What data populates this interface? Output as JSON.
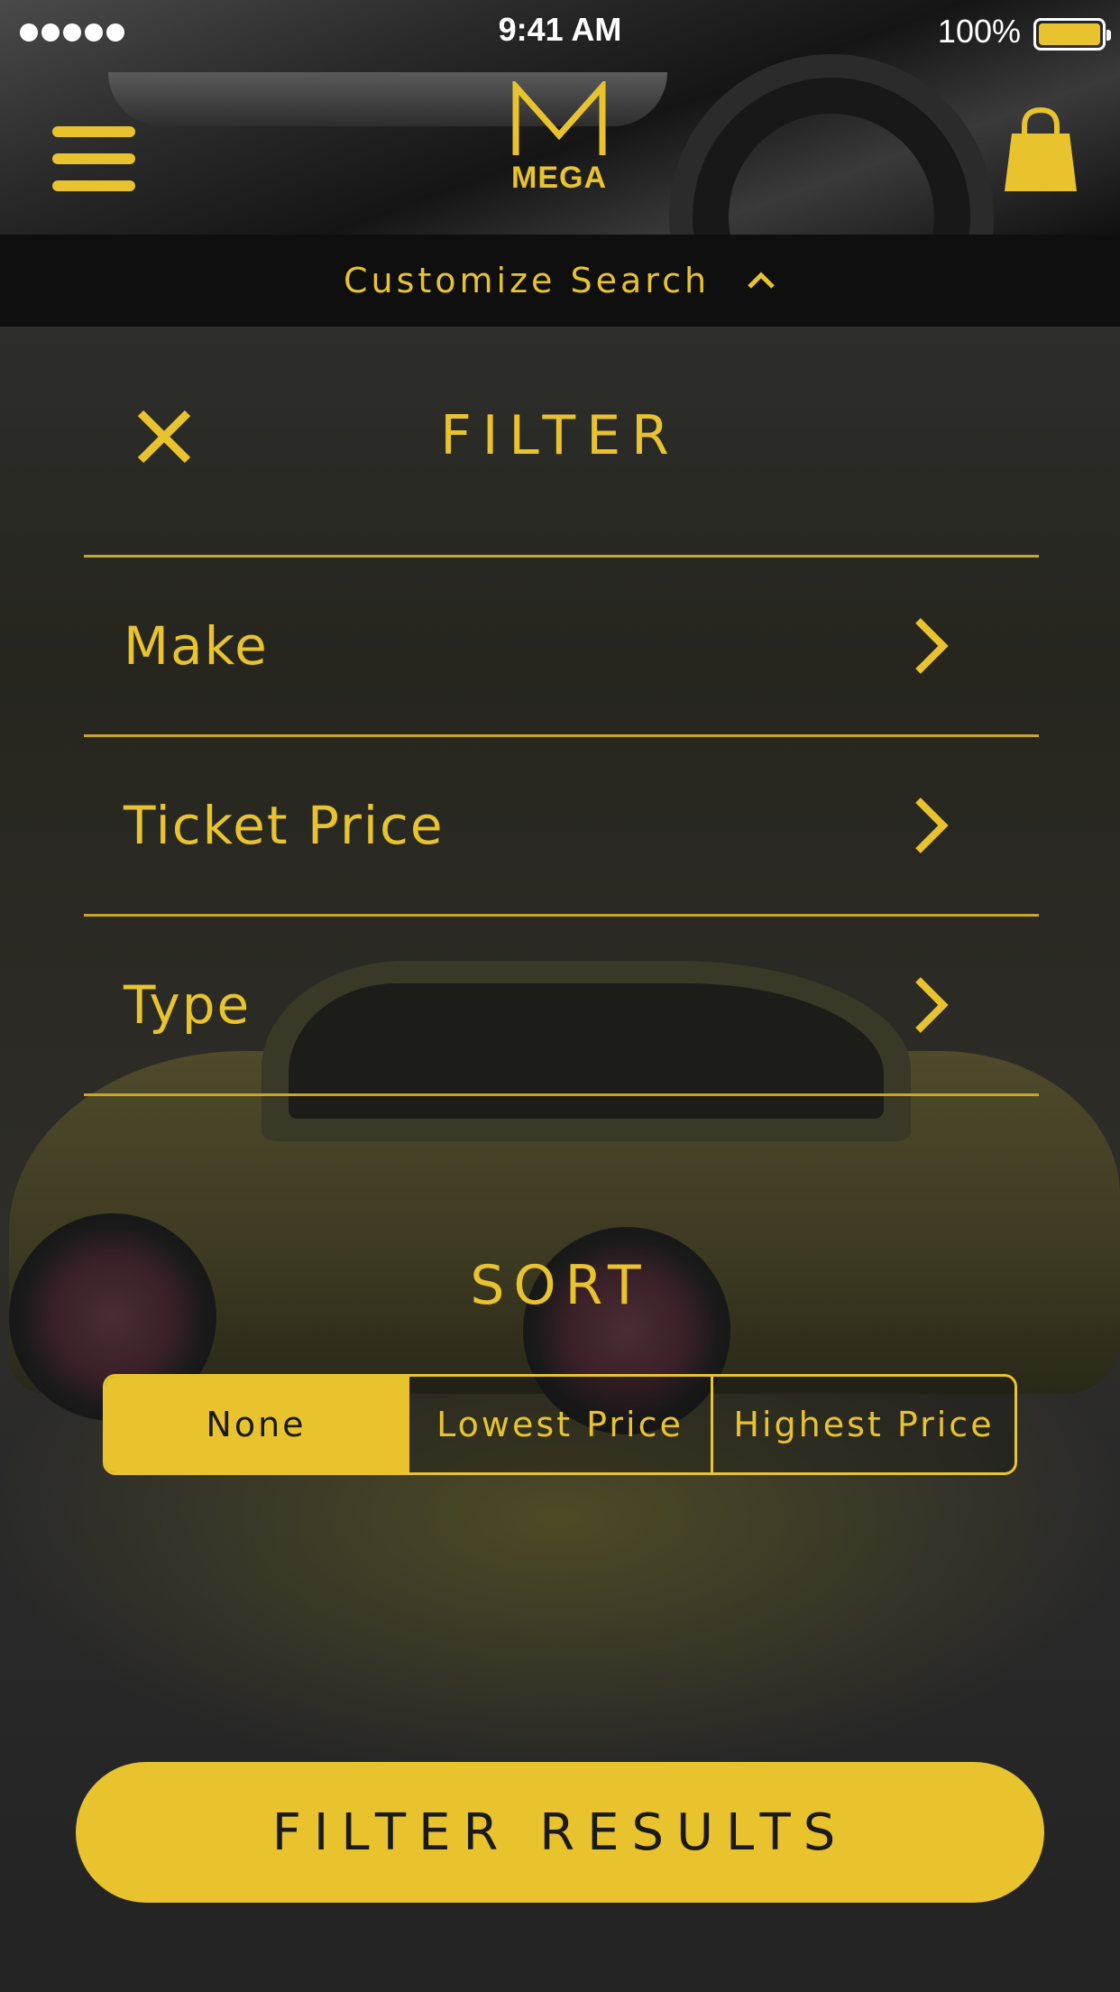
{
  "status_bar": {
    "time": "9:41 AM",
    "battery_percent": "100%",
    "battery_level": 1.0,
    "signal_bars": 5
  },
  "header": {
    "logo_text": "MEGA",
    "menu_icon": "hamburger-menu-icon",
    "bag_icon": "shopping-bag-icon"
  },
  "customize_search": {
    "label": "Customize Search",
    "icon": "chevron-up-icon"
  },
  "filter": {
    "title": "FILTER",
    "close_icon": "close-icon",
    "items": [
      {
        "label": "Make"
      },
      {
        "label": "Ticket Price"
      },
      {
        "label": "Type"
      }
    ]
  },
  "sort": {
    "title": "SORT",
    "options": [
      {
        "label": "None",
        "selected": true
      },
      {
        "label": "Lowest Price",
        "selected": false
      },
      {
        "label": "Highest Price",
        "selected": false
      }
    ]
  },
  "action": {
    "filter_results_label": "FILTER RESULTS"
  },
  "colors": {
    "accent": "#e9c32e",
    "bar_background": "#0f0f0f",
    "text_on_accent": "#1a1a1a"
  }
}
